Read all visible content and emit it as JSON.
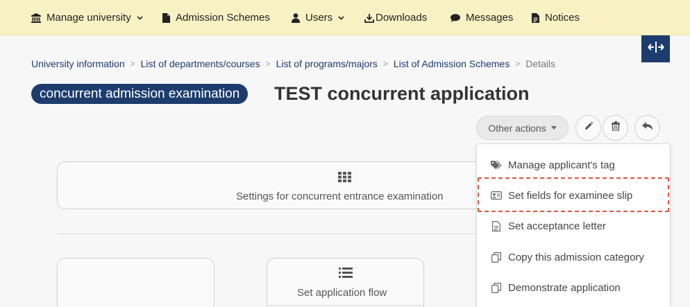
{
  "nav": {
    "manage_university": "Manage university",
    "admission_schemes": "Admission Schemes",
    "users": "Users",
    "downloads": "Downloads",
    "messages": "Messages",
    "notices": "Notices"
  },
  "breadcrumb": [
    "University information",
    "List of departments/courses",
    "List of programs/majors",
    "List of Admission Schemes",
    "Details"
  ],
  "header": {
    "badge": "concurrent admission examination",
    "title": "TEST concurrent application"
  },
  "actions": {
    "other_actions_label": "Other actions"
  },
  "cards": {
    "settings_label": "Settings for concurrent entrance examination",
    "flow_label": "Set application flow"
  },
  "dropdown": {
    "items": [
      "Manage applicant's tag",
      "Set fields for examinee slip",
      "Set acceptance letter",
      "Copy this admission category",
      "Demonstrate application"
    ]
  },
  "colors": {
    "nav_bg": "#f8f1c4",
    "accent": "#1d3c6e",
    "highlight_border": "#d9533c",
    "page_bg": "#f7f7f7"
  },
  "icons": {
    "manage_university": "university-icon",
    "admission_schemes": "file-icon",
    "users": "user-icon",
    "downloads": "download-icon",
    "messages": "comment-icon",
    "notices": "file-text-icon",
    "collapse": "expand-horizontal-icon",
    "edit": "pencil-icon",
    "delete": "trash-icon",
    "back": "reply-icon"
  }
}
